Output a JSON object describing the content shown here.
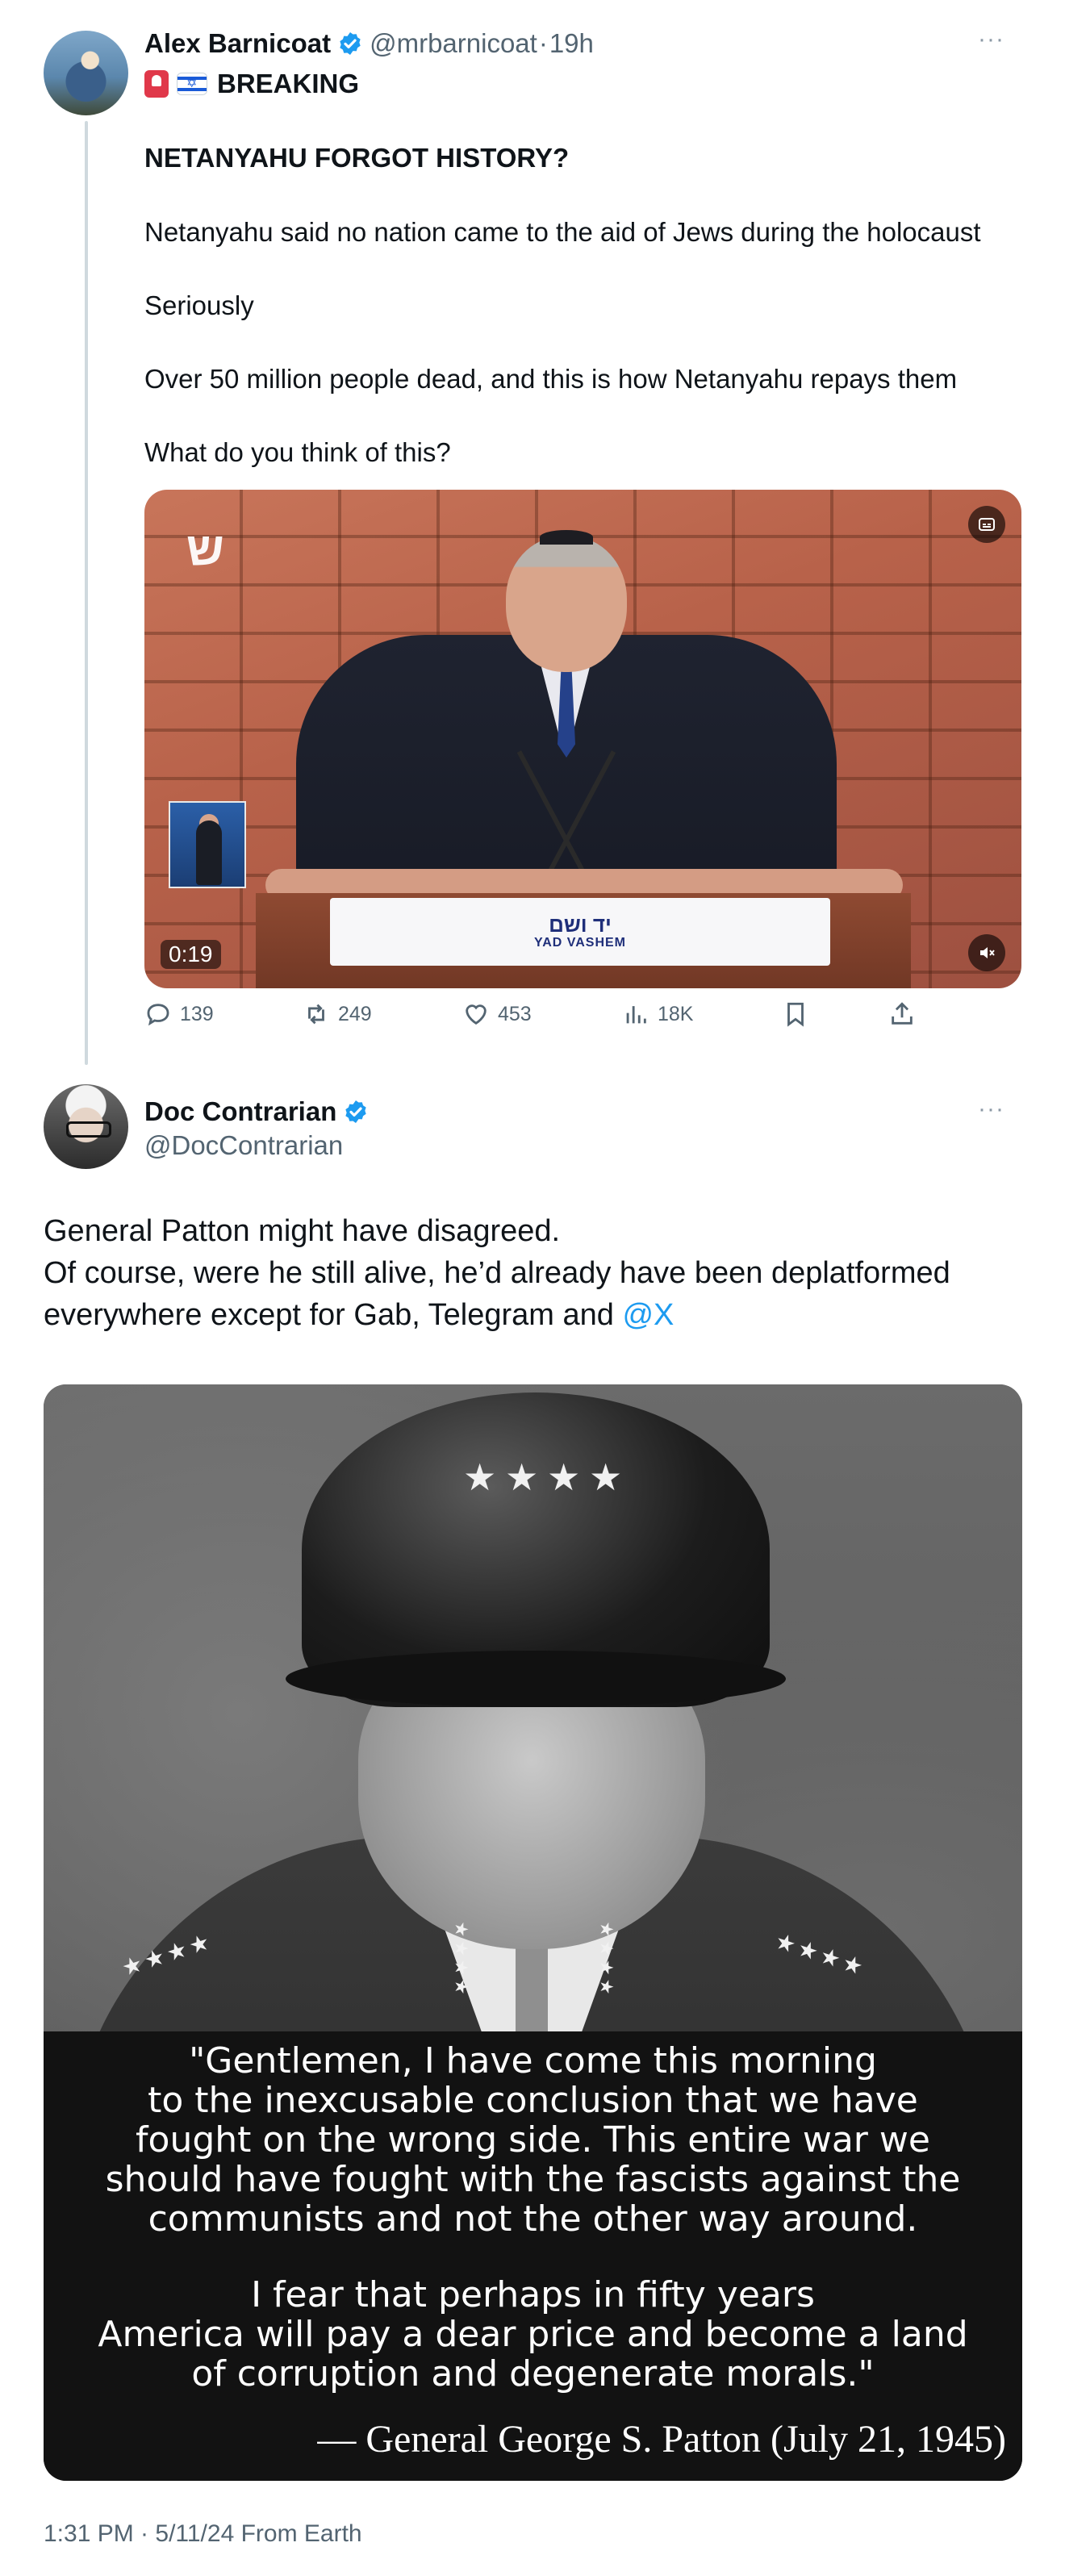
{
  "parent_tweet": {
    "author_name": "Alex Barnicoat",
    "handle": "@mrbarnicoat",
    "separator": "·",
    "time": "19h",
    "lines": [
      "BREAKING",
      "NETANYAHU FORGOT HISTORY?",
      "Netanyahu said no nation came to the aid of Jews during the holocaust",
      "Seriously",
      "Over 50 million people dead, and this is how Netanyahu repays them",
      "What do you think of this?"
    ],
    "video": {
      "duration": "0:19",
      "podium_hebrew": "יד ושם",
      "podium_english": "YAD VASHEM"
    },
    "stats": {
      "replies": "139",
      "reposts": "249",
      "likes": "453",
      "views": "18K"
    }
  },
  "reply_tweet": {
    "author_name": "Doc Contrarian",
    "handle": "@DocContrarian",
    "text_lines": [
      "General Patton might have disagreed.",
      "Of course, were he still alive, he’d already have been deplatformed",
      "everywhere except for Gab, Telegram and "
    ],
    "mention": "@X",
    "image_quote": [
      "\"Gentlemen, I have come this morning",
      "to the inexcusable conclusion that we have",
      "fought on the wrong side. This entire war we",
      "should have fought with the fascists against the",
      "communists and not the other way around.",
      "I fear that perhaps in fifty years",
      "America will pay a dear price and become a land",
      "of corruption and degenerate morals.\""
    ],
    "image_attribution": "— General George S. Patton (July 21, 1945)",
    "footer": "1:31 PM · 5/11/24 From Earth"
  },
  "icons": {
    "verified": "verified-badge-icon",
    "more": "more-icon",
    "reply": "reply-icon",
    "repost": "repost-icon",
    "like": "heart-icon",
    "views": "views-icon",
    "bookmark": "bookmark-icon",
    "share": "share-icon"
  },
  "colors": {
    "accent": "#1d9bf0",
    "text": "#0f1419",
    "secondary": "#536471"
  }
}
